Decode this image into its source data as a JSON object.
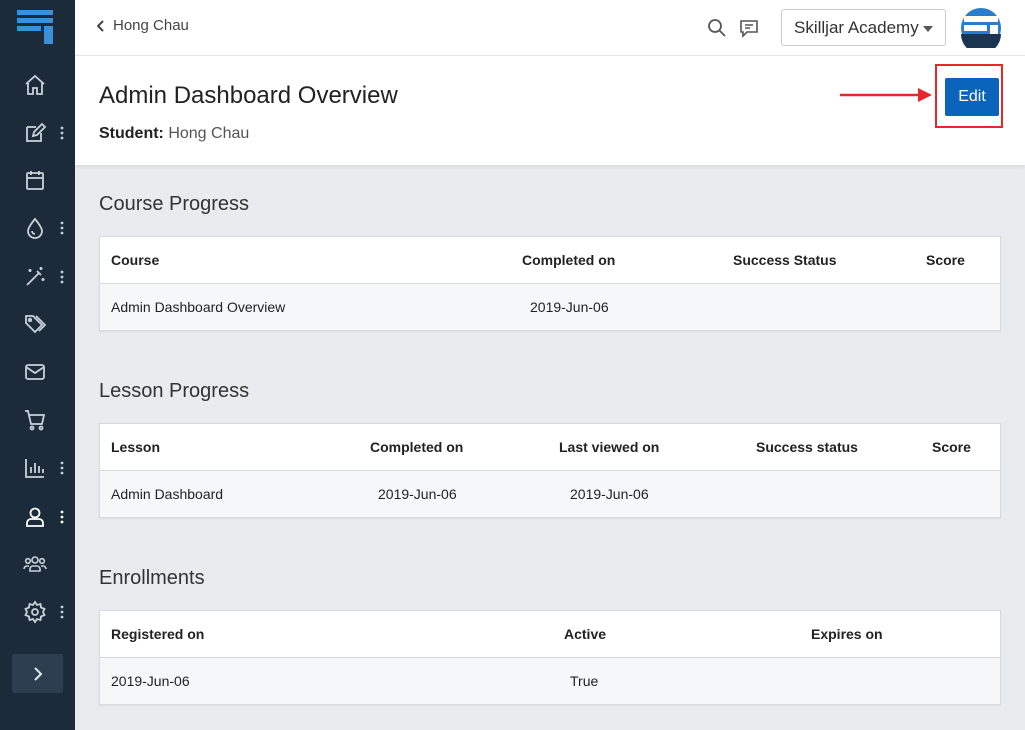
{
  "header": {
    "back_label": "Hong Chau",
    "org_select": "Skilljar Academy"
  },
  "page": {
    "title": "Admin Dashboard Overview",
    "student_label": "Student:",
    "student_name": "Hong Chau",
    "edit_label": "Edit"
  },
  "course_progress": {
    "title": "Course Progress",
    "columns": [
      "Course",
      "Completed on",
      "Success Status",
      "Score"
    ],
    "rows": [
      [
        "Admin Dashboard Overview",
        "2019-Jun-06",
        "",
        ""
      ]
    ]
  },
  "lesson_progress": {
    "title": "Lesson Progress",
    "columns": [
      "Lesson",
      "Completed on",
      "Last viewed on",
      "Success status",
      "Score"
    ],
    "rows": [
      [
        "Admin Dashboard",
        "2019-Jun-06",
        "2019-Jun-06",
        "",
        ""
      ]
    ]
  },
  "enrollments": {
    "title": "Enrollments",
    "columns": [
      "Registered on",
      "Active",
      "Expires on"
    ],
    "rows": [
      [
        "2019-Jun-06",
        "True",
        ""
      ]
    ]
  },
  "sidebar": {
    "items": [
      "home-icon",
      "edit-icon",
      "calendar-icon",
      "droplet-icon",
      "magic-wand-icon",
      "tag-icon",
      "mail-icon",
      "cart-icon",
      "chart-icon",
      "user-icon",
      "users-icon",
      "gear-icon"
    ]
  },
  "colors": {
    "sidebar": "#1b2b3a",
    "primary": "#0a64b9",
    "highlight": "#e8262b"
  }
}
